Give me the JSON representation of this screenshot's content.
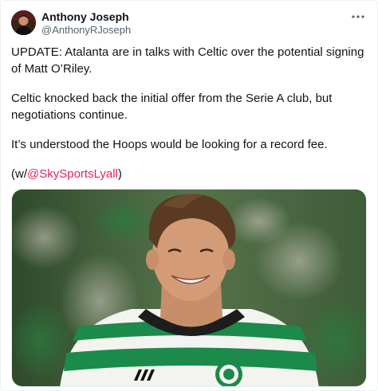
{
  "author": {
    "name": "Anthony Joseph",
    "handle": "@AnthonyRJoseph"
  },
  "tweet": {
    "paragraphs": [
      "UPDATE: Atalanta are in talks with Celtic over the potential signing of Matt O’Riley.",
      "Celtic knocked back the initial offer from the Serie A club, but negotiations continue.",
      "It’s understood the Hoops would be looking for a record fee."
    ],
    "credit_prefix": "(w/",
    "credit_mention": "@SkySportsLyall",
    "credit_suffix": ")"
  },
  "icons": {
    "more": "more-options-icon"
  },
  "colors": {
    "mention": "#e0245e",
    "secondary_text": "#536471",
    "jersey_green": "#1b8a4a"
  }
}
